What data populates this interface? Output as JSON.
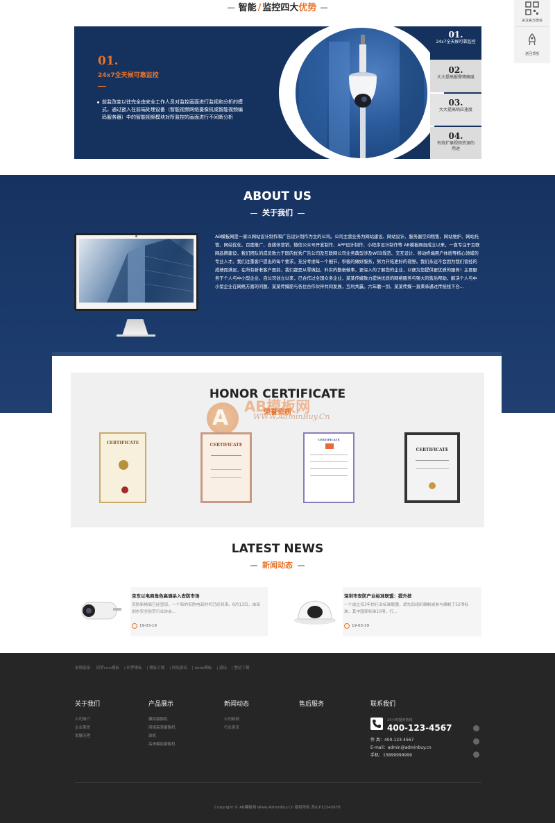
{
  "advantages": {
    "title_left": "智能",
    "title_mid": "监控四大",
    "title_hl": "优势",
    "active": {
      "num": "01.",
      "title": "24x7全天候可靠监控",
      "text": "前监改变以往完全由安全工作人员对监控画面进行监视和分析的模式，通过嵌入在前端处理设备（智能视频网络摄像机或智能视频编码服务器）中的智能视频模块对所监控的画面进行不间断分析"
    },
    "tabs": [
      {
        "num": "01.",
        "label": "24x7全天候可靠监控"
      },
      {
        "num": "02.",
        "label": "大大提高报警精确度"
      },
      {
        "num": "03.",
        "label": "大大提高响应速度"
      },
      {
        "num": "04.",
        "label": "有效扩展视频资源的用途"
      }
    ]
  },
  "float_bar": {
    "qr_label": "关注官方微信",
    "top_label": "返回顶部"
  },
  "about": {
    "title": "ABOUT US",
    "subtitle": "关于我们",
    "text": "AB模板网是一家以网站设计制作和广告设计制作为主的公司。公司主营业务为网站建设、网站设计、服务器空间租售、网站维护、网站托管、网站优化、百度推广、自媒体营销、微信公众号开发制作、APP设计制作、小程序设计制作等 AB模板网自成立以来，一直专注于互联网品牌建设，我们团队的成员致力于国内优秀广告公司及互联网公司业务典型涉及WEB规范、交互设计、移动终端用户体验等核心领域的专业人才。我们注重客户提出的每个要求，充分考虑每一个细节，积极的做好服务，努力开拓更好的视野。我们永远不会因为我们曾经的成绩而满足，在所有新老客户面前，我们都是从零做起，朴实的勤奋做事，更深入的了解您的企业，以便为您提供更优质的服务！主要服务于个人与中小型企业，自公司创立以来，已合作过全国众多企业，某某传媒致力提供优质的网络服务与强大的售后帮助，解决个人与中小型企业在网络方面的问题，某某传媒愿与各位合作伙伴共同发展，互利共赢。六年磨一剑，某某传媒一直秉承通过传统线下合..."
  },
  "honor": {
    "title": "HONOR CERTIFICATE",
    "subtitle": "荣誉资质",
    "watermark": "AB模板网",
    "watermark_url": "WWW.AdminBuy.Cn",
    "certs": [
      {
        "label": "CERTIFICATE"
      },
      {
        "label": "CERTIFICATE"
      },
      {
        "label": "CERTIFICATE"
      },
      {
        "label": "CERTIFICATE"
      }
    ]
  },
  "news": {
    "title": "LATEST NEWS",
    "subtitle": "新闻动态",
    "items": [
      {
        "title": "京东以电商角色高调杀入安防市场",
        "summary": "安防新格局已经显现，一个新的安防电商时代已经到来。8月13日，由深圳市安全防范行业协会...",
        "date": "19-03-19"
      },
      {
        "title": "深圳市安防产业标准联盟：提升技",
        "summary": "一个成立仅3年的行业标准联盟，却先后组织编制或参与编制了52项标准，其中国家标准10项、行...",
        "date": "19-03-19"
      }
    ]
  },
  "footer": {
    "links_label": "友情链接",
    "links": [
      "织梦cms模板",
      "织梦模板",
      "模板下载",
      "网站源码",
      "dede模板",
      "源码",
      "整站下载"
    ],
    "columns": [
      {
        "title": "关于我们",
        "items": [
          "公司简介",
          "企业荣誉",
          "发展历程"
        ]
      },
      {
        "title": "产品展示",
        "items": [
          "模拟摄像机",
          "网络高清摄像机",
          "球机",
          "高清模拟摄像机"
        ]
      },
      {
        "title": "新闻动态",
        "items": [
          "公司新闻",
          "行业资讯"
        ]
      },
      {
        "title": "售后服务",
        "items": []
      }
    ],
    "contact": {
      "title": "联系我们",
      "tel_label": "24小时服务热线",
      "tel": "400-123-4567",
      "fax": "传  真：400-123-4567",
      "email": "E-mail：admin@adminbuy.cn",
      "mobile": "手机：15899999999"
    },
    "copyright": "Copyright © AB模板网 Www.AdminBuy.Cn 版权所有  苏ICP12345678"
  }
}
